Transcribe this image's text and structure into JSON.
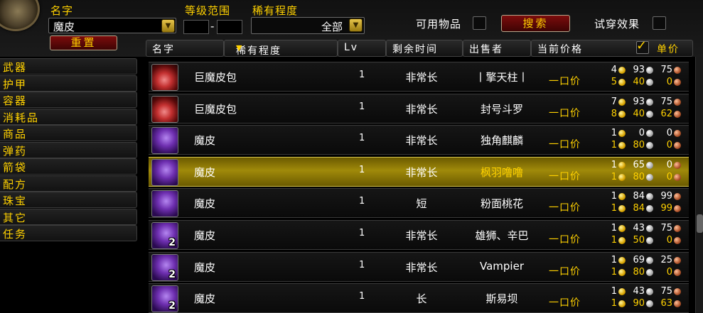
{
  "search": {
    "name_label": "名字",
    "name_value": "魔皮",
    "level_label": "等级范围",
    "level_sep": "-",
    "rarity_label": "稀有程度",
    "rarity_value": "全部",
    "usable_label": "可用物品",
    "search_button": "搜索",
    "preview_label": "试穿效果",
    "reset_button": "重置"
  },
  "categories": [
    "武器",
    "护甲",
    "容器",
    "消耗品",
    "商品",
    "弹药",
    "箭袋",
    "配方",
    "珠宝",
    "其它",
    "任务"
  ],
  "columns": {
    "name": "名字",
    "rarity": "稀有程度",
    "level": "Lv",
    "time_left": "剩余时间",
    "seller": "出售者",
    "current_price": "当前价格",
    "unit_price": "单价"
  },
  "icon_names": {
    "sort": "sort-arrow-icon",
    "check": "checkmark-icon"
  },
  "rows": [
    {
      "name": "巨魔皮包",
      "icon": "bag",
      "stack": "",
      "level": "1",
      "time": "非常长",
      "seller": "丨擎天柱丨",
      "buyout_label": "一口价",
      "bid": {
        "g": "4",
        "s": "93",
        "c": "75"
      },
      "buy": {
        "g": "5",
        "s": "40",
        "c": "0"
      }
    },
    {
      "name": "巨魔皮包",
      "icon": "bag",
      "stack": "",
      "level": "1",
      "time": "非常长",
      "seller": "封号斗罗",
      "buyout_label": "一口价",
      "bid": {
        "g": "7",
        "s": "93",
        "c": "75"
      },
      "buy": {
        "g": "8",
        "s": "40",
        "c": "62"
      }
    },
    {
      "name": "魔皮",
      "icon": "hide",
      "stack": "",
      "level": "1",
      "time": "非常长",
      "seller": "独角麒麟",
      "buyout_label": "一口价",
      "bid": {
        "g": "1",
        "s": "0",
        "c": "0"
      },
      "buy": {
        "g": "1",
        "s": "80",
        "c": "0"
      }
    },
    {
      "name": "魔皮",
      "icon": "hide",
      "stack": "",
      "level": "1",
      "time": "非常长",
      "seller": "枫羽噜噜",
      "buyout_label": "一口价",
      "bid": {
        "g": "1",
        "s": "65",
        "c": "0"
      },
      "buy": {
        "g": "1",
        "s": "80",
        "c": "0"
      }
    },
    {
      "name": "魔皮",
      "icon": "hide",
      "stack": "",
      "level": "1",
      "time": "短",
      "seller": "粉面桃花",
      "buyout_label": "一口价",
      "bid": {
        "g": "1",
        "s": "84",
        "c": "99"
      },
      "buy": {
        "g": "1",
        "s": "84",
        "c": "99"
      }
    },
    {
      "name": "魔皮",
      "icon": "hide",
      "stack": "2",
      "level": "1",
      "time": "非常长",
      "seller": "雄狮、辛巴",
      "buyout_label": "一口价",
      "bid": {
        "g": "1",
        "s": "43",
        "c": "75"
      },
      "buy": {
        "g": "1",
        "s": "50",
        "c": "0"
      }
    },
    {
      "name": "魔皮",
      "icon": "hide",
      "stack": "2",
      "level": "1",
      "time": "非常长",
      "seller": "Vampier",
      "buyout_label": "一口价",
      "bid": {
        "g": "1",
        "s": "69",
        "c": "25"
      },
      "buy": {
        "g": "1",
        "s": "80",
        "c": "0"
      }
    },
    {
      "name": "魔皮",
      "icon": "hide",
      "stack": "2",
      "level": "1",
      "time": "长",
      "seller": "斯易坝",
      "buyout_label": "一口价",
      "bid": {
        "g": "1",
        "s": "43",
        "c": "75"
      },
      "buy": {
        "g": "1",
        "s": "90",
        "c": "63"
      }
    }
  ],
  "selected_row": 3
}
